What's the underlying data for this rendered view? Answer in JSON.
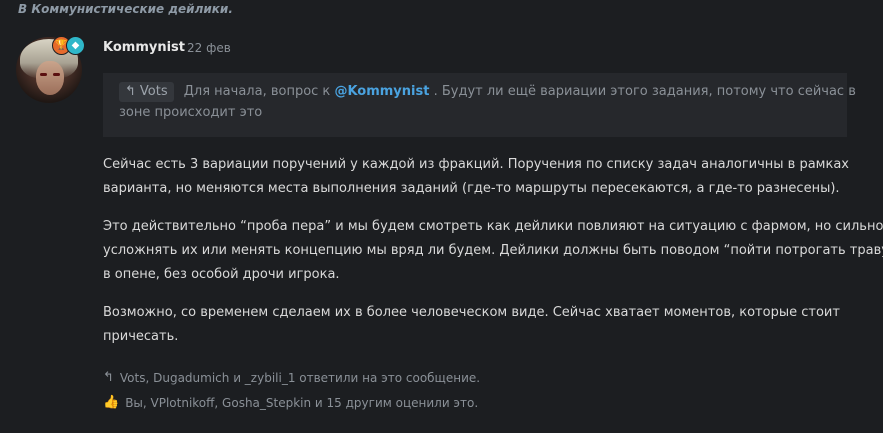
{
  "thread_link": "В Коммунистические дейлики.",
  "post": {
    "avatar_icon": "user-avatar",
    "badges": [
      {
        "icon": "trophy-icon",
        "color": "#e66a2c",
        "glyph": "🏆"
      },
      {
        "icon": "diamond-icon",
        "color": "#2fb7c9",
        "glyph": "◆"
      }
    ],
    "username": "Kommynist",
    "date": "22 фев",
    "quote": {
      "author": "Vots",
      "reply_icon": "reply-arrow-icon",
      "line1_before": "Для начала, вопрос к",
      "mention": "@Kommynist",
      "line1_after": ". Будут ли ещё вариации этого задания, потому что сейчас в",
      "line2": "зоне происходит это"
    },
    "paragraphs": [
      [
        "Сейчас есть 3 вариации поручений у каждой из фракций. Поручения по списку задач аналогичны в рамках",
        "варианта, но меняются места выполнения заданий (где-то маршруты пересекаются, а где-то разнесены)."
      ],
      [
        "Это действительно “проба пера” и мы будем смотреть как дейлики повлияют на ситуацию с фармом, но сильно",
        "усложнять их или менять концепцию мы вряд ли будем. Дейлики должны быть поводом “пойти потрогать траву”",
        "в опене, без особой дрочи игрока."
      ],
      [
        "Возможно, со временем сделаем их в более человеческом виде. Сейчас хватает моментов, которые стоит",
        "причесать."
      ]
    ],
    "replies_text": "Vots, Dugadumich и _zybili_1 ответили на это сообщение.",
    "likes_text": "Вы, VPlotnikoff, Gosha_Stepkin и 15 другим оценили это."
  },
  "colors": {
    "background": "#1c1e21",
    "quote_background": "#26282c",
    "mention": "#4aa3e0",
    "muted_text": "#8a9097",
    "body_text": "#d9d9d9"
  }
}
